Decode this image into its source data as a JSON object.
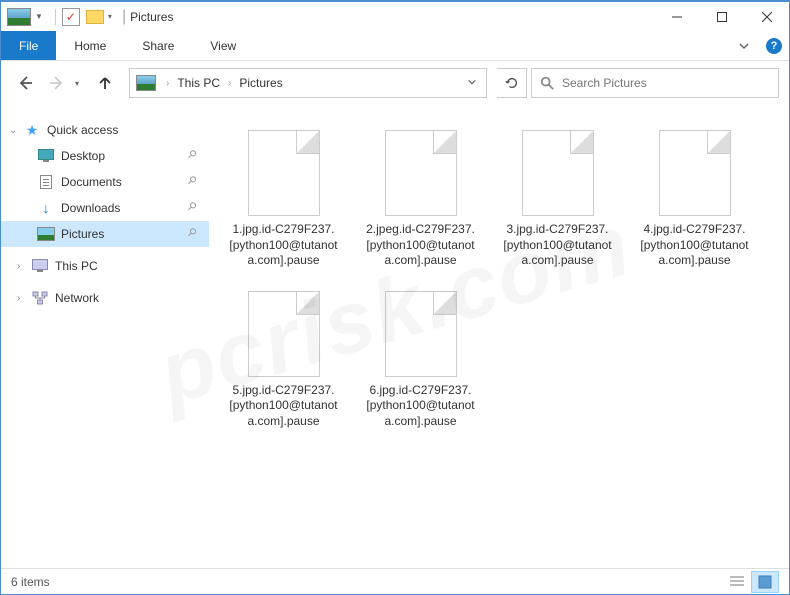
{
  "window": {
    "title": "Pictures"
  },
  "ribbon": {
    "file": "File",
    "tabs": [
      "Home",
      "Share",
      "View"
    ]
  },
  "breadcrumbs": {
    "items": [
      "This PC",
      "Pictures"
    ]
  },
  "search": {
    "placeholder": "Search Pictures"
  },
  "nav_pane": {
    "quick_access": {
      "label": "Quick access",
      "expanded": true,
      "items": [
        {
          "label": "Desktop",
          "pinned": true,
          "icon": "monitor"
        },
        {
          "label": "Documents",
          "pinned": true,
          "icon": "document"
        },
        {
          "label": "Downloads",
          "pinned": true,
          "icon": "download"
        },
        {
          "label": "Pictures",
          "pinned": true,
          "icon": "picture",
          "selected": true
        }
      ]
    },
    "this_pc": {
      "label": "This PC"
    },
    "network": {
      "label": "Network"
    }
  },
  "files": [
    {
      "name": "1.jpg.id-C279F237.[python100@tutanota.com].pause"
    },
    {
      "name": "2.jpeg.id-C279F237.[python100@tutanota.com].pause"
    },
    {
      "name": "3.jpg.id-C279F237.[python100@tutanota.com].pause"
    },
    {
      "name": "4.jpg.id-C279F237.[python100@tutanota.com].pause"
    },
    {
      "name": "5.jpg.id-C279F237.[python100@tutanota.com].pause"
    },
    {
      "name": "6.jpg.id-C279F237.[python100@tutanota.com].pause"
    }
  ],
  "status": {
    "count_text": "6 items"
  },
  "watermark": "pcrisk.com"
}
